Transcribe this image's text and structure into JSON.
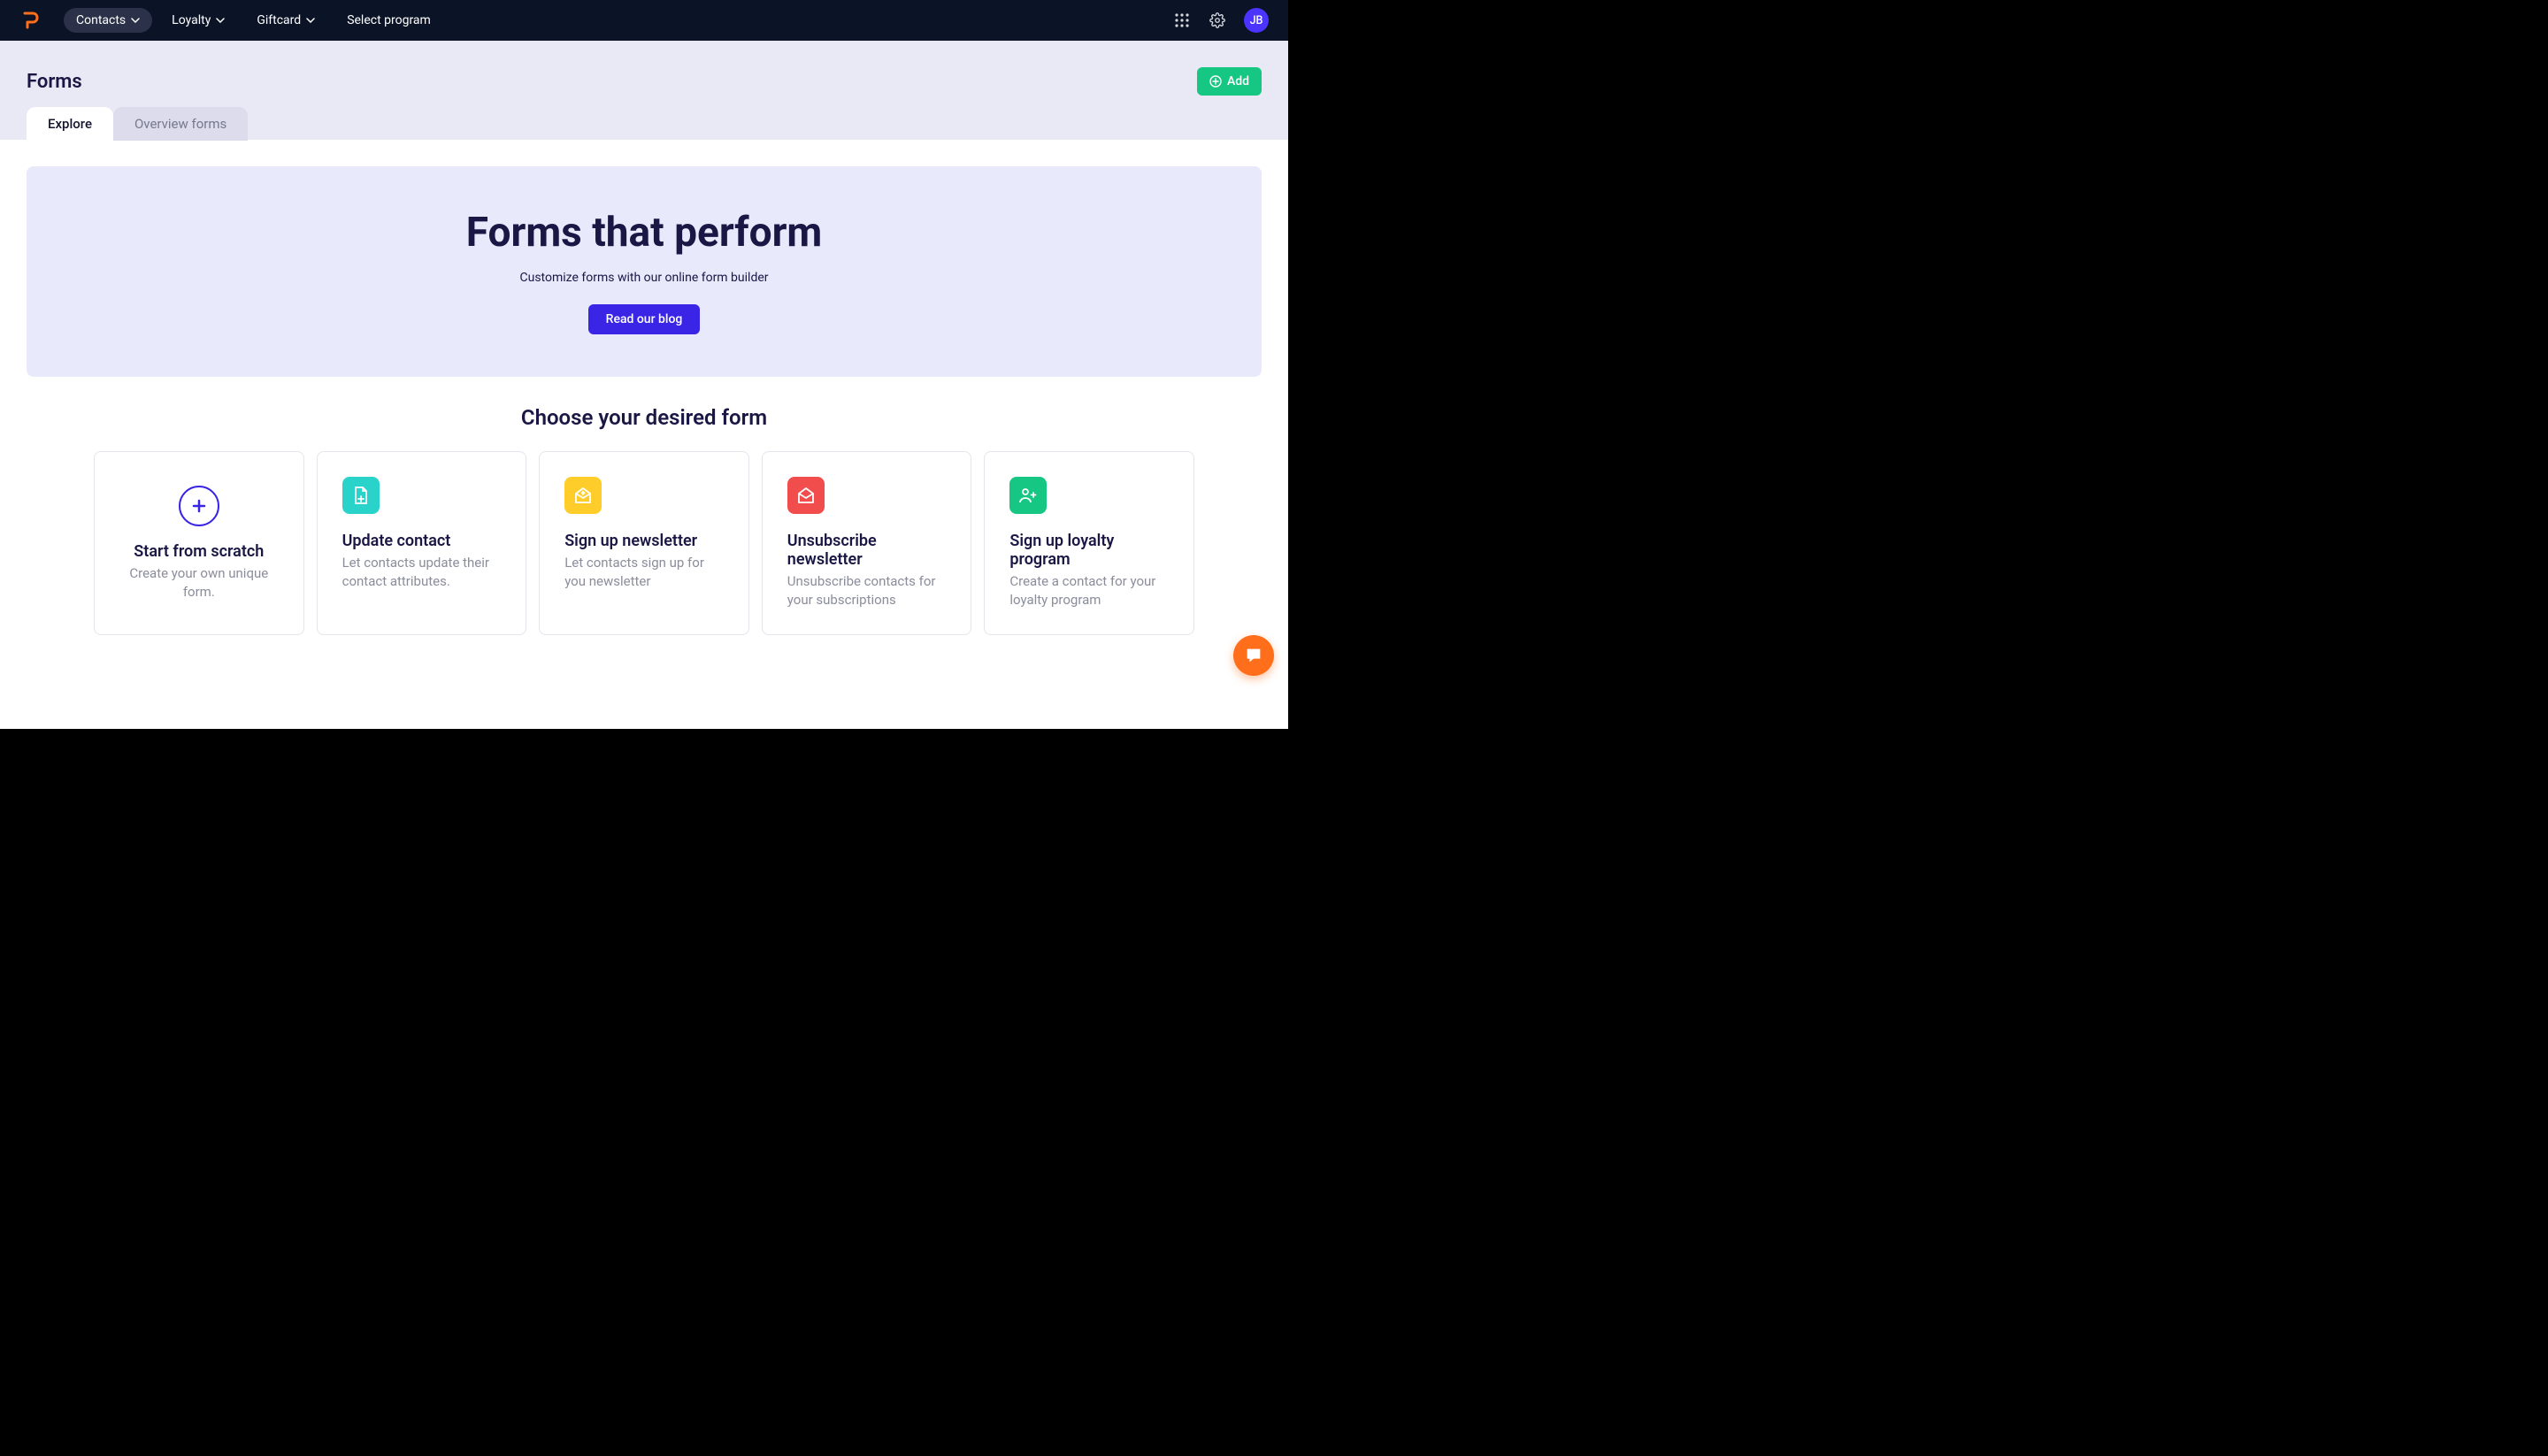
{
  "nav": {
    "items": [
      {
        "label": "Contacts",
        "hasChevron": true,
        "active": true
      },
      {
        "label": "Loyalty",
        "hasChevron": true,
        "active": false
      },
      {
        "label": "Giftcard",
        "hasChevron": true,
        "active": false
      },
      {
        "label": "Select program",
        "hasChevron": false,
        "active": false
      }
    ],
    "avatar": "JB"
  },
  "header": {
    "title": "Forms",
    "addBtn": "Add"
  },
  "tabs": [
    {
      "label": "Explore",
      "active": true
    },
    {
      "label": "Overview forms",
      "active": false
    }
  ],
  "hero": {
    "title": "Forms that perform",
    "subtitle": "Customize forms with our online form builder",
    "cta": "Read our blog"
  },
  "sectionTitle": "Choose your desired form",
  "cards": [
    {
      "title": "Start from scratch",
      "desc": "Create your own unique form."
    },
    {
      "title": "Update contact",
      "desc": "Let contacts update their contact attributes."
    },
    {
      "title": "Sign up newsletter",
      "desc": "Let contacts sign up for you newsletter"
    },
    {
      "title": "Unsubscribe newsletter",
      "desc": "Unsubscribe contacts for your subscriptions"
    },
    {
      "title": "Sign up loyalty program",
      "desc": "Create a contact for your loyalty program"
    }
  ]
}
